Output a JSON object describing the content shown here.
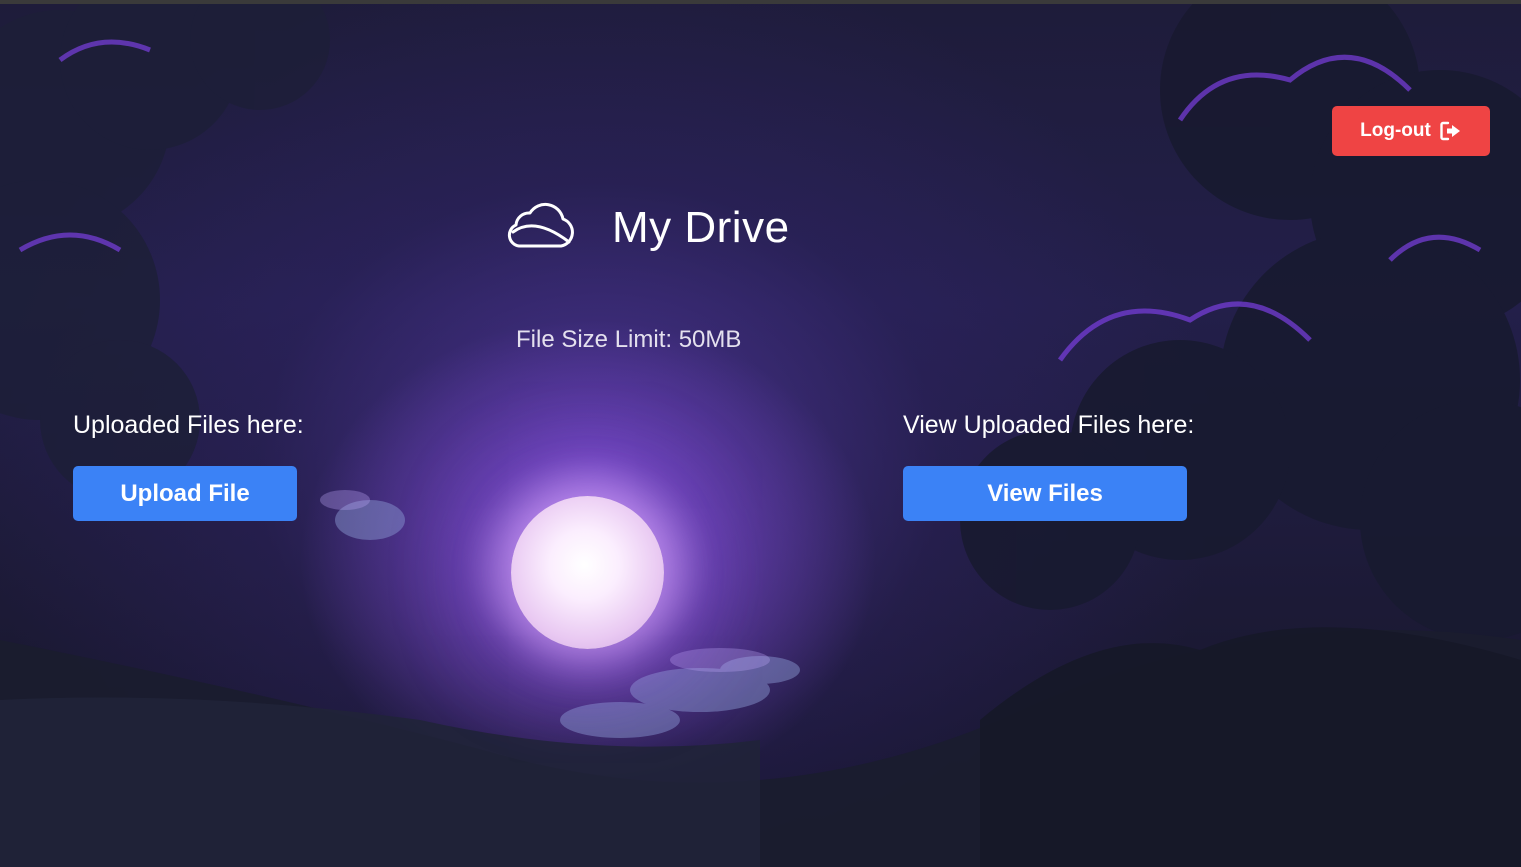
{
  "header": {
    "title": "My Drive",
    "logo_icon": "cloud-icon"
  },
  "info": {
    "file_size_limit": "File Size Limit:  50MB"
  },
  "upload_section": {
    "label": "Uploaded Files here:",
    "button_label": "Upload File"
  },
  "view_section": {
    "label": "View Uploaded Files here:",
    "button_label": "View Files"
  },
  "logout": {
    "label": "Log-out",
    "icon": "sign-out-icon"
  },
  "colors": {
    "primary_button": "#3b82f6",
    "danger_button": "#ef4444",
    "text": "#ffffff"
  }
}
